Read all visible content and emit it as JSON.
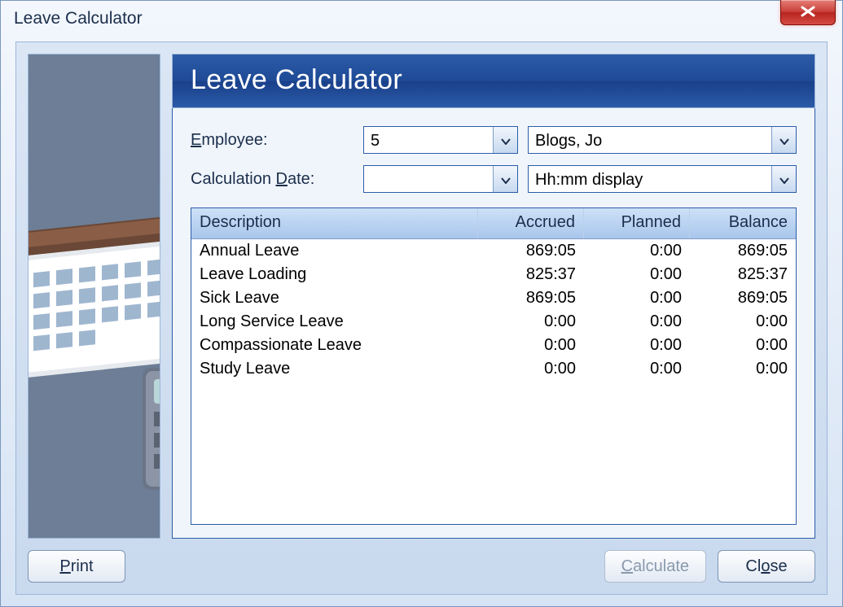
{
  "window": {
    "title": "Leave Calculator"
  },
  "banner": {
    "heading": "Leave Calculator"
  },
  "form": {
    "employee_label": "Employee:",
    "employee_label_ul": "E",
    "employee_label_rest": "mployee:",
    "employee_id": "5",
    "employee_name": "Blogs, Jo",
    "date_label_pre": "Calculation ",
    "date_label_ul": "D",
    "date_label_rest": "ate:",
    "calculation_date": "",
    "display_format": "Hh:mm display"
  },
  "table": {
    "headers": {
      "description": "Description",
      "accrued": "Accrued",
      "planned": "Planned",
      "balance": "Balance"
    },
    "rows": [
      {
        "description": "Annual Leave",
        "accrued": "869:05",
        "planned": "0:00",
        "balance": "869:05"
      },
      {
        "description": "Leave Loading",
        "accrued": "825:37",
        "planned": "0:00",
        "balance": "825:37"
      },
      {
        "description": "Sick Leave",
        "accrued": "869:05",
        "planned": "0:00",
        "balance": "869:05"
      },
      {
        "description": "Long Service Leave",
        "accrued": "0:00",
        "planned": "0:00",
        "balance": "0:00"
      },
      {
        "description": "Compassionate Leave",
        "accrued": "0:00",
        "planned": "0:00",
        "balance": "0:00"
      },
      {
        "description": "Study Leave",
        "accrued": "0:00",
        "planned": "0:00",
        "balance": "0:00"
      }
    ]
  },
  "buttons": {
    "print_ul": "P",
    "print_rest": "rint",
    "calculate_ul": "C",
    "calculate_rest": "alculate",
    "close_pre": "Cl",
    "close_ul": "o",
    "close_rest": "se"
  }
}
